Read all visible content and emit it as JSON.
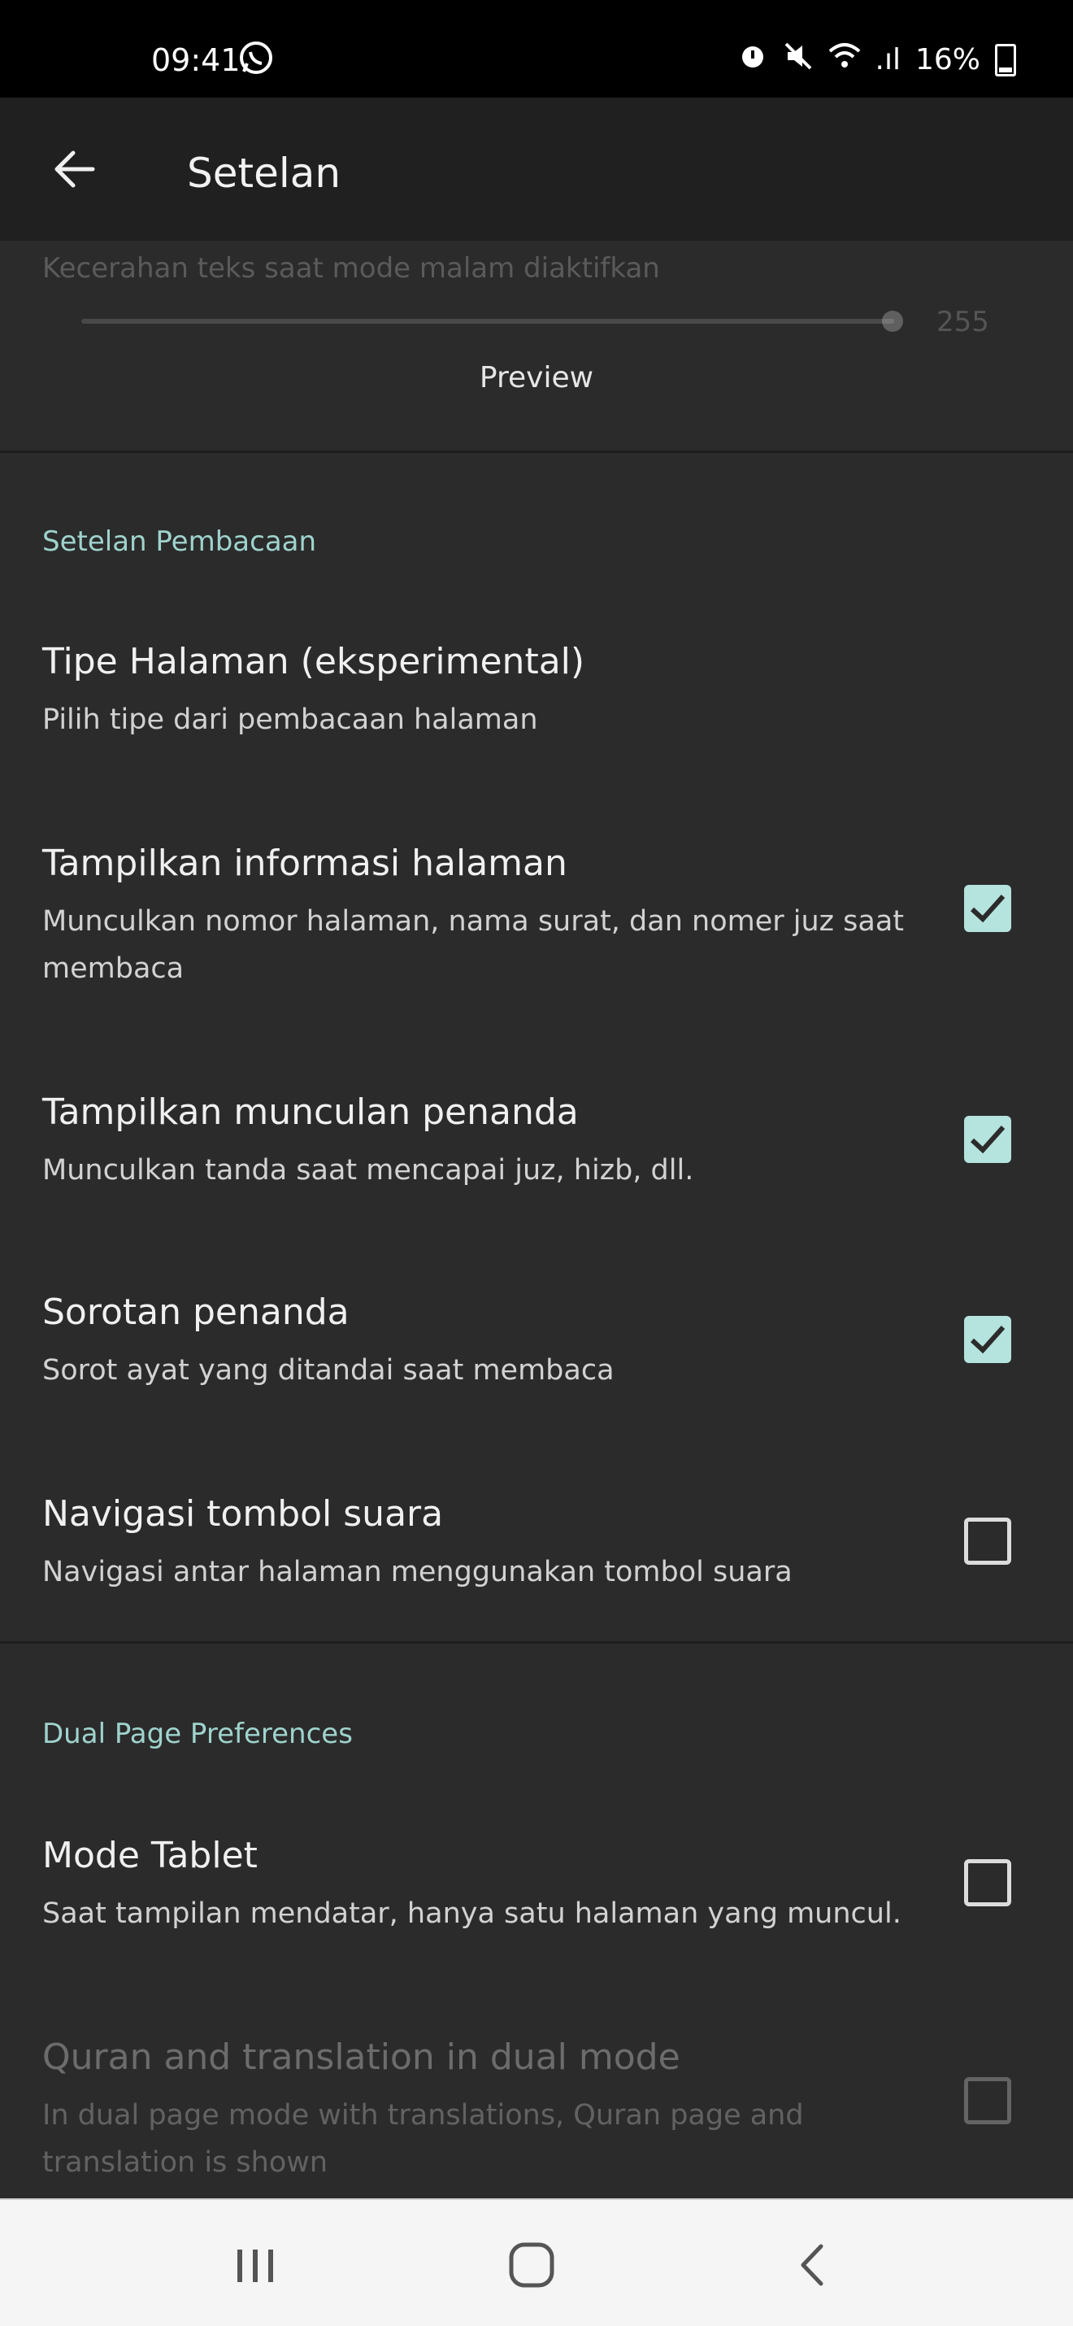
{
  "status": {
    "time": "09:41",
    "battery": "16%",
    "signal": ".ıl"
  },
  "appbar": {
    "title": "Setelan"
  },
  "night": {
    "brightness_label": "Kecerahan teks saat mode malam diaktifkan",
    "brightness_value": "255",
    "brightness_level": 1.0,
    "preview_label": "Preview"
  },
  "reading": {
    "header": "Setelan Pembacaan",
    "page_type": {
      "title": "Tipe Halaman (eksperimental)",
      "summary": "Pilih tipe dari pembacaan halaman"
    },
    "page_info": {
      "title": "Tampilkan informasi halaman",
      "summary": "Munculkan nomor halaman, nama surat, dan nomer juz saat membaca",
      "checked": true
    },
    "marker_popup": {
      "title": "Tampilkan munculan penanda",
      "summary": "Munculkan tanda saat mencapai juz, hizb, dll.",
      "checked": true
    },
    "marker_highlight": {
      "title": "Sorotan penanda",
      "summary": "Sorot ayat yang ditandai saat membaca",
      "checked": true
    },
    "volume_nav": {
      "title": "Navigasi tombol suara",
      "summary": "Navigasi antar halaman menggunakan tombol suara",
      "checked": false
    }
  },
  "dual": {
    "header": "Dual Page Preferences",
    "tablet_mode": {
      "title": "Mode Tablet",
      "summary": "Saat tampilan mendatar, hanya satu halaman yang muncul.",
      "checked": false
    },
    "dual_translation": {
      "title": "Quran and translation in dual mode",
      "summary": "In dual page mode with translations, Quran page and translation is shown",
      "checked": false
    }
  },
  "colors": {
    "accent": "#9fd3cd",
    "checkbox_on": "#b5e3dd",
    "background": "#2b2b2b",
    "appbar": "#202020"
  },
  "icons": {
    "back": "arrow-left-icon",
    "whatsapp": "whatsapp-icon",
    "alarm": "alarm-icon",
    "mute": "mute-icon",
    "wifi": "wifi-icon"
  }
}
